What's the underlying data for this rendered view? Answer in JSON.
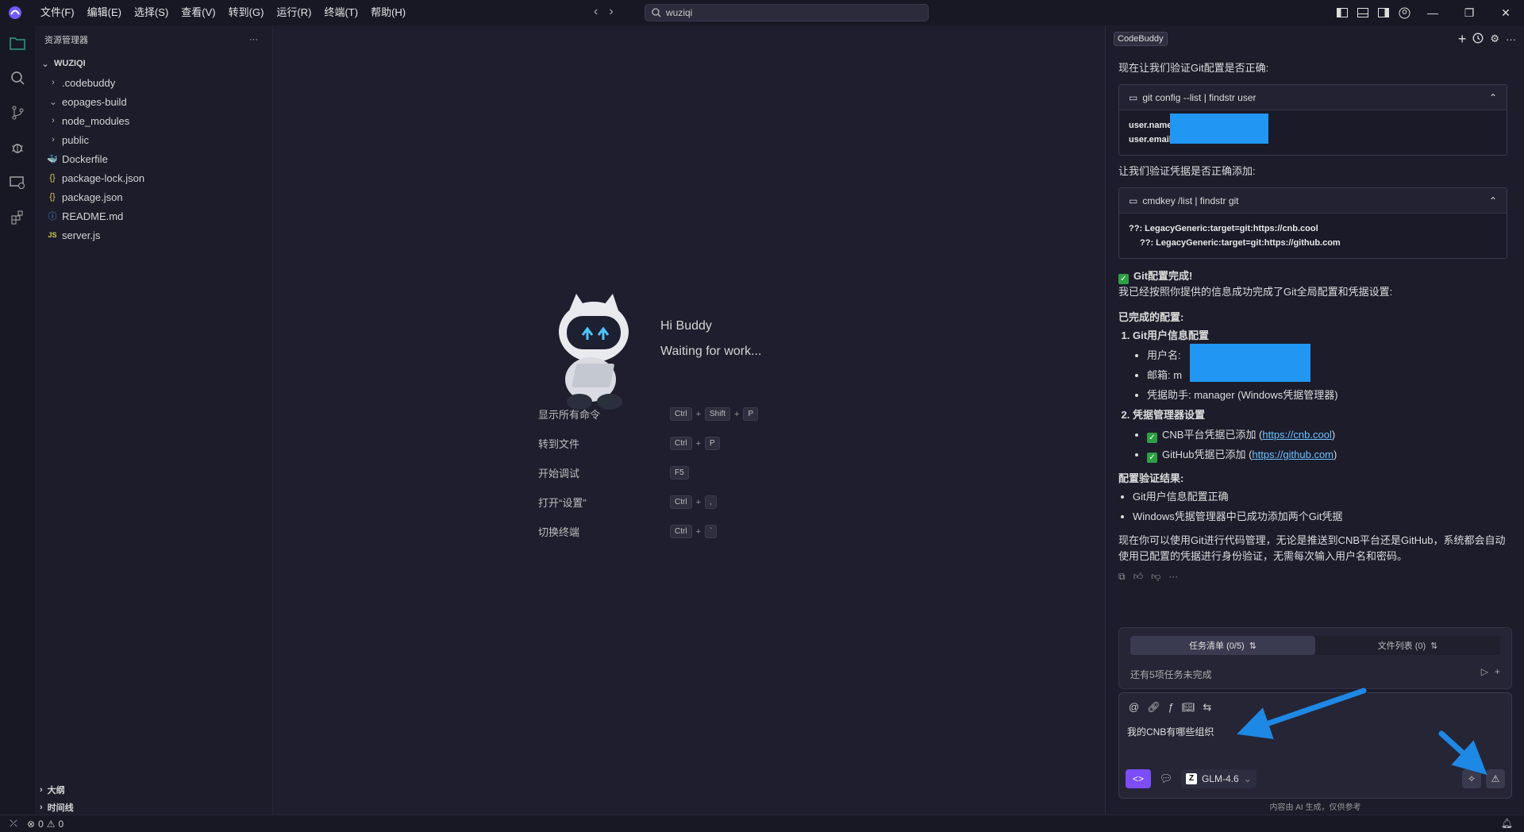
{
  "menu": [
    "文件(F)",
    "编辑(E)",
    "选择(S)",
    "查看(V)",
    "转到(G)",
    "运行(R)",
    "终端(T)",
    "帮助(H)"
  ],
  "search": {
    "value": "wuziqi"
  },
  "sidebar": {
    "title": "资源管理器",
    "root": "WUZIQI",
    "items": [
      {
        "label": ".codebuddy",
        "type": "folder",
        "chevron": ">"
      },
      {
        "label": "eopages-build",
        "type": "folder",
        "chevron": "v"
      },
      {
        "label": "node_modules",
        "type": "folder",
        "chevron": ">"
      },
      {
        "label": "public",
        "type": "folder",
        "chevron": ">"
      },
      {
        "label": "Dockerfile",
        "type": "docker"
      },
      {
        "label": "package-lock.json",
        "type": "json"
      },
      {
        "label": "package.json",
        "type": "json"
      },
      {
        "label": "README.md",
        "type": "info"
      },
      {
        "label": "server.js",
        "type": "js"
      }
    ],
    "outline": "大纲",
    "timeline": "时间线"
  },
  "welcome": {
    "title": "Hi Buddy",
    "subtitle": "Waiting for work...",
    "shortcuts": [
      {
        "label": "显示所有命令",
        "keys": [
          "Ctrl",
          "Shift",
          "P"
        ]
      },
      {
        "label": "转到文件",
        "keys": [
          "Ctrl",
          "P"
        ]
      },
      {
        "label": "开始调试",
        "keys": [
          "F5"
        ]
      },
      {
        "label": "打开“设置”",
        "keys": [
          "Ctrl",
          ","
        ]
      },
      {
        "label": "切换终端",
        "keys": [
          "Ctrl",
          "`"
        ]
      }
    ]
  },
  "panel": {
    "tag": "CodeBuddy",
    "msg1": "现在让我们验证Git配置是否正确:",
    "cmd1": {
      "command": "git config --list | findstr user",
      "lines": [
        "user.name=",
        "user.email="
      ]
    },
    "msg2": "让我们验证凭据是否正确添加:",
    "cmd2": {
      "command": "cmdkey /list | findstr git",
      "lines": [
        "??: LegacyGeneric:target=git:https://cnb.cool",
        "??: LegacyGeneric:target=git:https://github.com"
      ]
    },
    "done_title": "Git配置完成!",
    "done_desc": "我已经按照你提供的信息成功完成了Git全局配置和凭据设置:",
    "completed_heading": "已完成的配置:",
    "section1": "Git用户信息配置",
    "username_label": "用户名:",
    "email_label": "邮箱: m",
    "helper": "凭据助手: manager (Windows凭据管理器)",
    "section2": "凭据管理器设置",
    "cnb_text": "CNB平台凭据已添加 (",
    "cnb_link": "https://cnb.cool",
    "github_text": "GitHub凭据已添加 (",
    "github_link": "https://github.com",
    "close_paren": ")",
    "verify_heading": "配置验证结果:",
    "verify1": "Git用户信息配置正确",
    "verify2": "Windows凭据管理器中已成功添加两个Git凭据",
    "summary": "现在你可以使用Git进行代码管理，无论是推送到CNB平台还是GitHub，系统都会自动使用已配置的凭据进行身份验证，无需每次输入用户名和密码。",
    "task_tab": "任务清单 (0/5)",
    "file_tab": "文件列表 (0)",
    "task_note": "还有5项任务未完成",
    "input_text": "我的CNB有哪些组织",
    "model": "GLM-4.6",
    "disclaimer": "内容由 AI 生成，仅供参考"
  },
  "status": {
    "errors": "0",
    "warnings": "0"
  },
  "colors": {
    "accent": "#7c4dff",
    "redaction": "#2196f3",
    "arrow": "#1e88e5",
    "check": "#2ea043"
  }
}
